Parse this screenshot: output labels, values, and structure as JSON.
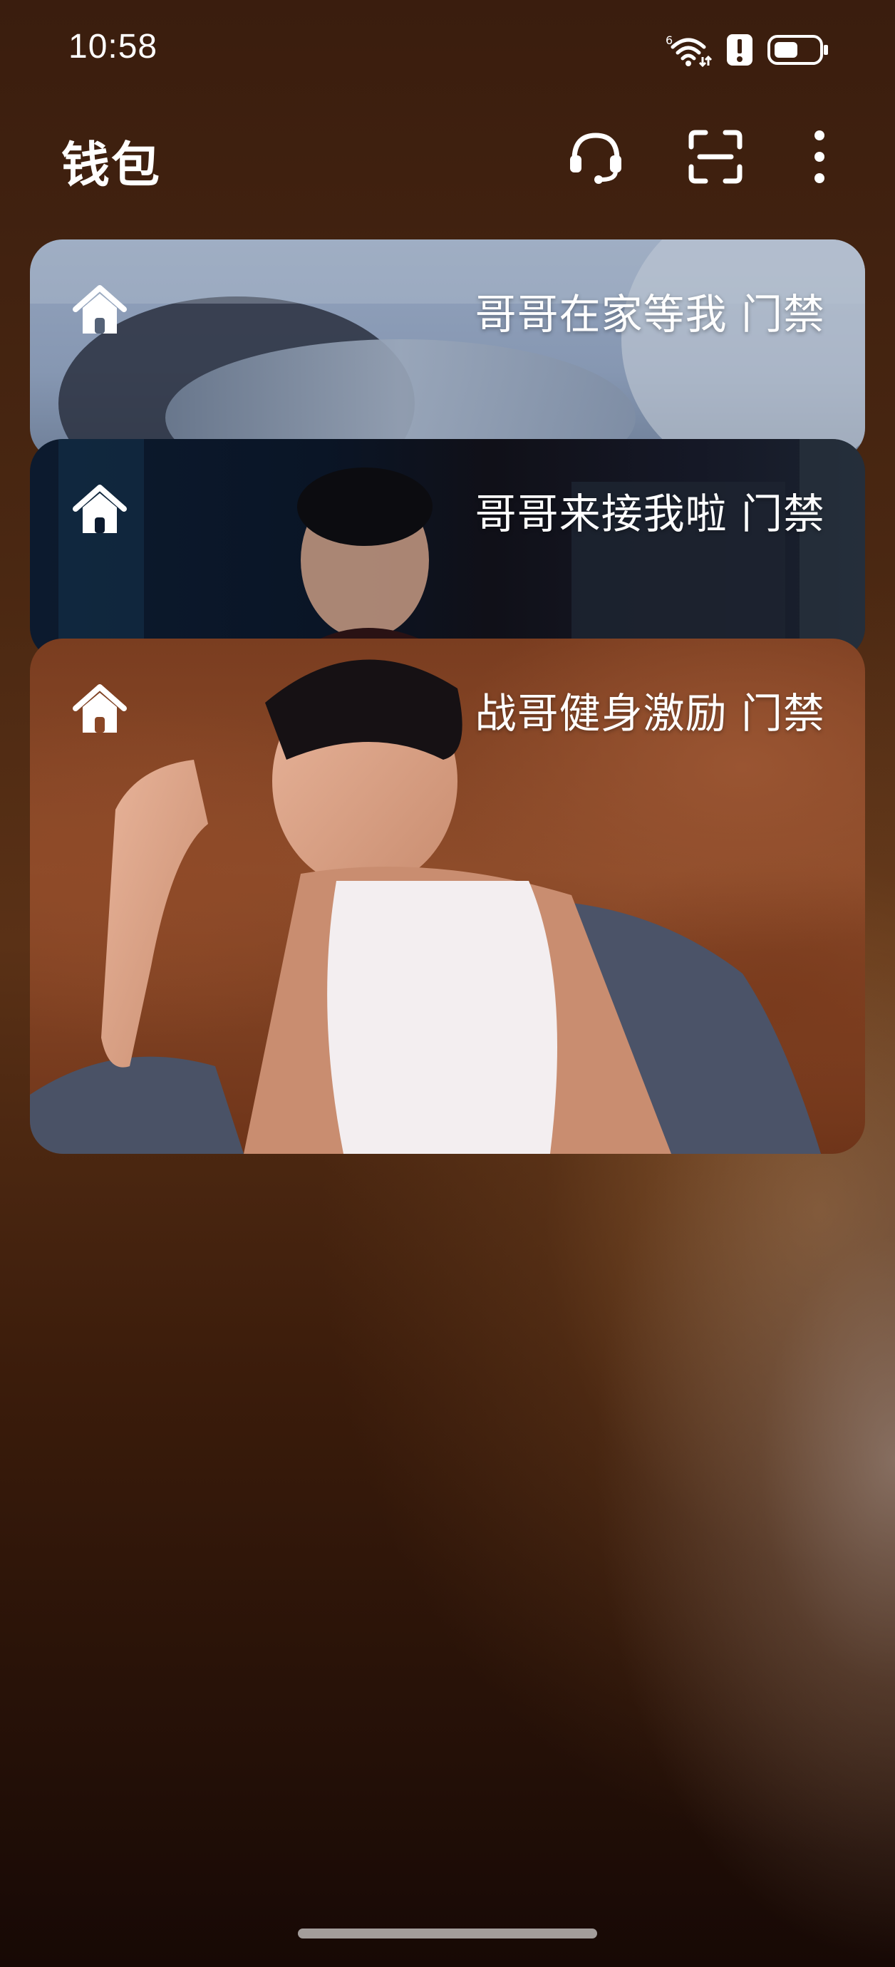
{
  "status_bar": {
    "time": "10:58",
    "icons": [
      "wifi-6-icon",
      "alert-icon",
      "battery-icon"
    ],
    "wifi_badge": "6"
  },
  "app_bar": {
    "title": "钱包",
    "actions": [
      "headset-icon",
      "scan-icon",
      "more-vert-icon"
    ]
  },
  "cards": [
    {
      "title": "哥哥在家等我 门禁",
      "icon": "home-icon"
    },
    {
      "title": "哥哥来接我啦 门禁",
      "icon": "home-icon"
    },
    {
      "title": "战哥健身激励 门禁",
      "icon": "home-icon"
    }
  ],
  "theme": {
    "text": "#ffffff",
    "background_top": "#3a1d0e",
    "background_bottom": "#170905"
  }
}
